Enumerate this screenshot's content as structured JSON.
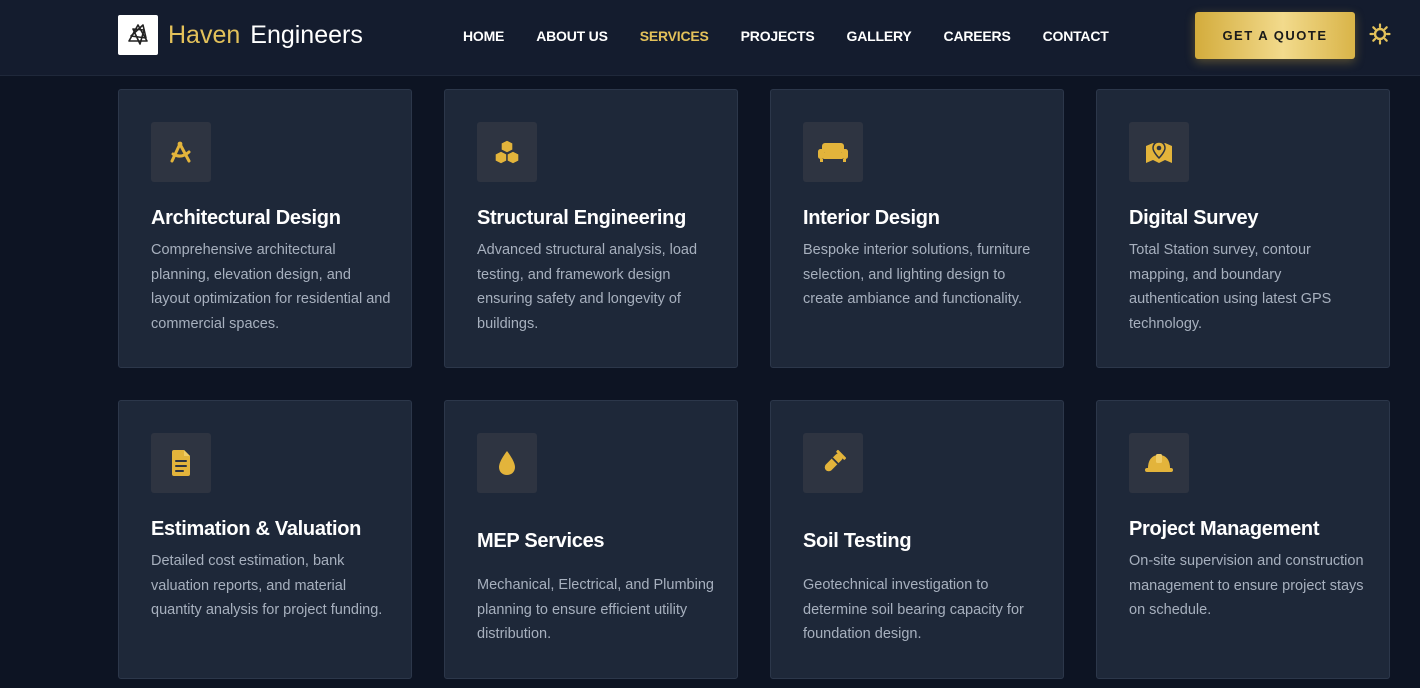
{
  "brand": {
    "first": "Haven",
    "second": "Engineers"
  },
  "nav": {
    "items": [
      {
        "label": "HOME",
        "active": false
      },
      {
        "label": "ABOUT US",
        "active": false
      },
      {
        "label": "SERVICES",
        "active": true
      },
      {
        "label": "PROJECTS",
        "active": false
      },
      {
        "label": "GALLERY",
        "active": false
      },
      {
        "label": "CAREERS",
        "active": false
      },
      {
        "label": "CONTACT",
        "active": false
      }
    ],
    "cta_label": "GET A QUOTE"
  },
  "services": [
    {
      "title": "Architectural Design",
      "description": "Comprehensive architectural planning, elevation design, and layout optimization for residential and commercial spaces.",
      "icon": "compass-drafting-icon"
    },
    {
      "title": "Structural Engineering",
      "description": "Advanced structural analysis, load testing, and framework design ensuring safety and longevity of buildings.",
      "icon": "cubes-icon"
    },
    {
      "title": "Interior Design",
      "description": "Bespoke interior solutions, furniture selection, and lighting design to create ambiance and functionality.",
      "icon": "couch-icon"
    },
    {
      "title": "Digital Survey",
      "description": "Total Station survey, contour mapping, and boundary authentication using latest GPS technology.",
      "icon": "map-pin-icon"
    },
    {
      "title": "Estimation & Valuation",
      "description": "Detailed cost estimation, bank valuation reports, and material quantity analysis for project funding.",
      "icon": "document-icon"
    },
    {
      "title": "MEP Services",
      "description": "Mechanical, Electrical, and Plumbing planning to ensure efficient utility distribution.",
      "icon": "water-drop-icon"
    },
    {
      "title": "Soil Testing",
      "description": "Geotechnical investigation to determine soil bearing capacity for foundation design.",
      "icon": "test-tube-icon"
    },
    {
      "title": "Project Management",
      "description": "On-site supervision and construction management to ensure project stays on schedule.",
      "icon": "hard-hat-icon"
    }
  ],
  "colors": {
    "accent": "#e3c15a",
    "background": "#0d1423",
    "card": "#1e2839",
    "nav": "#141c2e"
  }
}
